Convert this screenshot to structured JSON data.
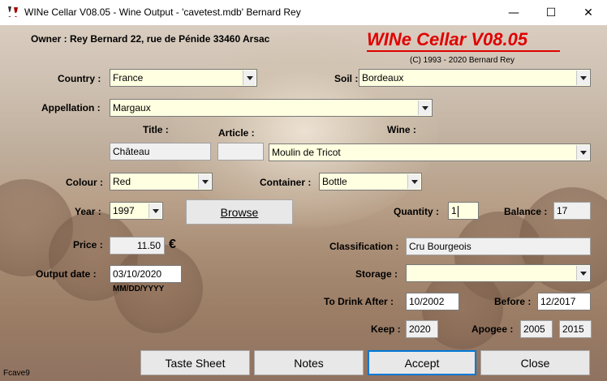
{
  "window": {
    "title": "WINe Cellar V08.05  - Wine Output -  'cavetest.mdb'  Bernard Rey",
    "minimize_glyph": "—",
    "maximize_glyph": "☐",
    "close_glyph": "✕"
  },
  "header": {
    "owner": "Owner : Rey Bernard 22, rue de Pénide 33460 Arsac",
    "brand": "WINe Cellar V08.05",
    "copyright": "(C) 1993 - 2020 Bernard Rey"
  },
  "labels": {
    "country": "Country :",
    "soil": "Soil :",
    "appellation": "Appellation :",
    "title": "Title :",
    "article": "Article :",
    "wine": "Wine :",
    "colour": "Colour :",
    "container": "Container :",
    "year": "Year :",
    "quantity": "Quantity :",
    "balance": "Balance :",
    "price": "Price :",
    "classification": "Classification :",
    "output_date": "Output date :",
    "date_format": "MM/DD/YYYY",
    "storage": "Storage :",
    "to_drink_after": "To Drink After :",
    "before": "Before :",
    "keep": "Keep :",
    "apogee": "Apogee :",
    "currency": "€"
  },
  "values": {
    "country": "France",
    "soil": "Bordeaux",
    "appellation": "Margaux",
    "title": "Château",
    "article": "",
    "wine": "Moulin de Tricot",
    "colour": "Red",
    "container": "Bottle",
    "year": "1997",
    "quantity": "1",
    "balance": "17",
    "price": "11.50",
    "classification": "Cru Bourgeois",
    "output_date": "03/10/2020",
    "storage": "",
    "to_drink_after": "10/2002",
    "before": "12/2017",
    "keep": "2020",
    "apogee_from": "2005",
    "apogee_to": "2015"
  },
  "buttons": {
    "browse": "Browse",
    "taste_sheet": "Taste Sheet",
    "notes": "Notes",
    "accept": "Accept",
    "close": "Close"
  },
  "status": "Fcave9"
}
